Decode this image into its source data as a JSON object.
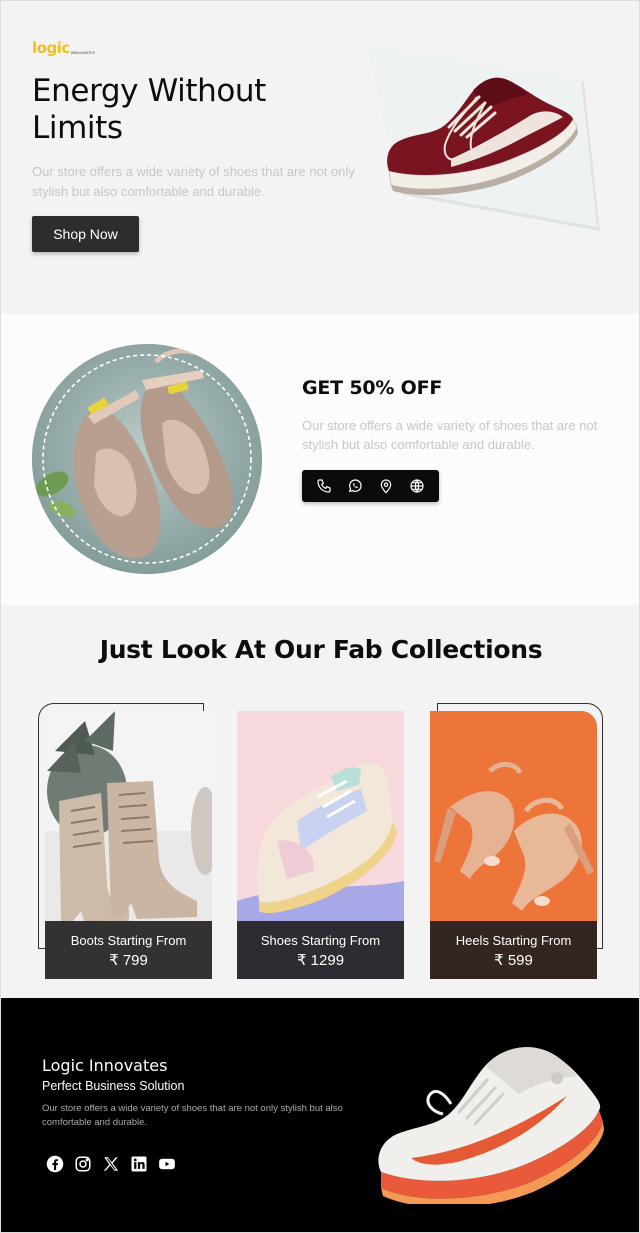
{
  "brand": {
    "logo_text": "logic",
    "logo_sub": "INNOVATES"
  },
  "hero": {
    "title": "Energy Without Limits",
    "description": "Our store offers a wide variety of shoes that are not only stylish but also comfortable and durable.",
    "cta_label": "Shop Now",
    "image_icon": "maroon-sneaker-icon"
  },
  "offer": {
    "title": "GET 50% OFF",
    "description": "Our store offers a wide variety of shoes that are not stylish but also comfortable and durable.",
    "image_icon": "ankle-strap-flats-icon",
    "contact_icons": [
      "phone-icon",
      "whatsapp-icon",
      "location-pin-icon",
      "globe-icon"
    ]
  },
  "collections": {
    "title": "Just Look At Our Fab Collections",
    "items": [
      {
        "label": "Boots Starting From",
        "price": "₹ 799",
        "icon": "boots-icon"
      },
      {
        "label": "Shoes Starting From",
        "price": "₹ 1299",
        "icon": "sneaker-icon"
      },
      {
        "label": "Heels Starting From",
        "price": "₹ 599",
        "icon": "heels-icon"
      }
    ]
  },
  "footer": {
    "brand": "Logic Innovates",
    "tagline": "Perfect Business Solution",
    "description": "Our store offers a wide variety of shoes that are not only stylish but also comfortable and durable.",
    "socials": [
      "facebook-icon",
      "instagram-icon",
      "x-icon",
      "linkedin-icon",
      "youtube-icon"
    ],
    "image_icon": "running-shoe-icon"
  },
  "colors": {
    "accent": "#f3be1a",
    "dark": "#2d2d2d",
    "footer_bg": "#000000",
    "section_bg": "#f3f3f3"
  }
}
